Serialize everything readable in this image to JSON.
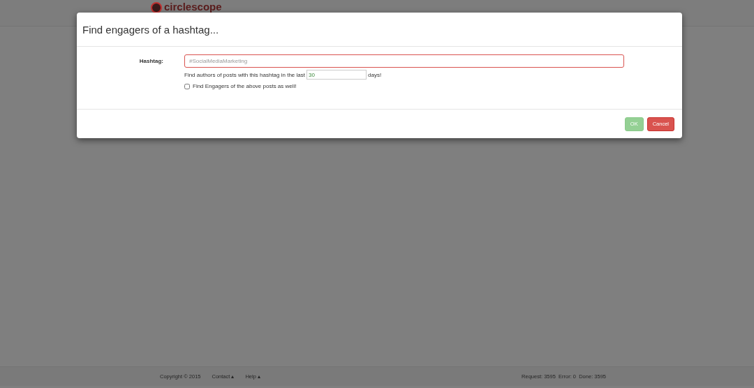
{
  "app": {
    "logo": "circlescope"
  },
  "dialog": {
    "title": "Find engagers of a hashtag...",
    "hashtag": {
      "label": "Hashtag:",
      "placeholder": "#SocialMediaMarketing"
    },
    "days": {
      "prefix": "Find authors of posts with this hashtag in the last",
      "value": "30",
      "suffix": "days!"
    },
    "engagers": {
      "label": "Find Engagers of the above posts as well!",
      "checked": false
    },
    "buttons": [
      {
        "label": "OK",
        "kind": "primary",
        "disabled": true
      },
      {
        "label": "Cancel",
        "kind": "danger",
        "disabled": false
      }
    ]
  },
  "footer": {
    "copyright": "Copyright © 2015",
    "links": [
      "Contact ▴",
      "Help ▴"
    ],
    "stats": "Request: 3595  Error: 0  Done: 3595"
  }
}
